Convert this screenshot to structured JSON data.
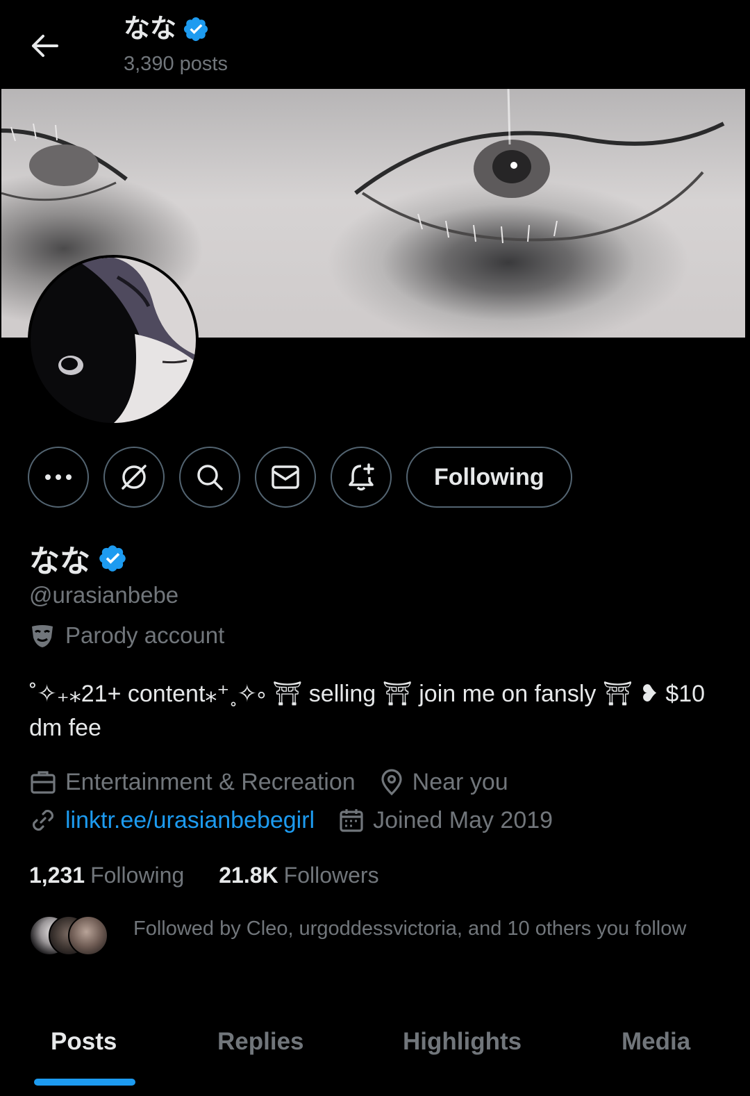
{
  "header": {
    "name": "なな",
    "posts": "3,390 posts"
  },
  "actions": {
    "following_label": "Following"
  },
  "profile": {
    "name": "なな",
    "handle": "@urasianbebe",
    "label": "Parody account",
    "bio": "˚✧₊⁎21+ content⁎⁺˳✧༚ ⛩ selling ⛩ join me on fansly ⛩ ❥ $10 dm fee",
    "category": "Entertainment & Recreation",
    "location": "Near you",
    "link": "linktr.ee/urasianbebegirl",
    "joined": "Joined May 2019"
  },
  "stats": {
    "following_count": "1,231",
    "following_label": "Following",
    "followers_count": "21.8K",
    "followers_label": "Followers"
  },
  "followed_by": "Followed by Cleo, urgoddessvictoria, and 10 others you follow",
  "tabs": [
    "Posts",
    "Replies",
    "Highlights",
    "Media"
  ],
  "colors": {
    "accent": "#1d9bf0",
    "background": "#000000",
    "text": "#e7e9ea",
    "muted": "#71767b"
  }
}
